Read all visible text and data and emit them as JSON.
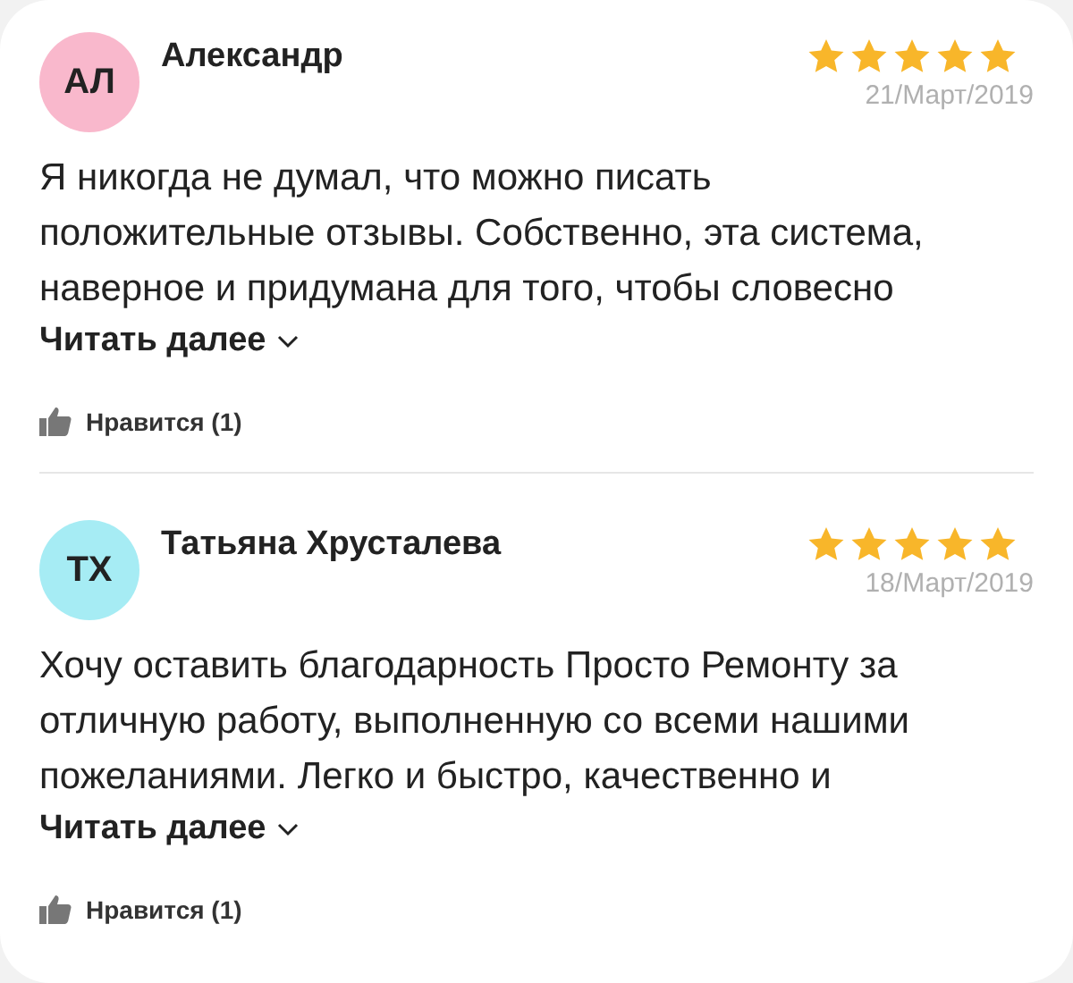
{
  "reviews": [
    {
      "initials": "АЛ",
      "color": "#f9b8cc",
      "name": "Александр",
      "stars": 5,
      "date": "21/Март/2019",
      "text_lines": [
        "Я никогда не думал, что можно писать",
        "положительные отзывы. Собственно, эта система,",
        "наверное и придумана для того, чтобы словесно"
      ],
      "read_more": "Читать далее",
      "like": "Нравится (1)"
    },
    {
      "initials": "ТХ",
      "color": "#a6ecf4",
      "name": "Татьяна Хрусталева",
      "stars": 5,
      "date": "18/Март/2019",
      "text_lines": [
        "Хочу оставить благодарность Просто Ремонту за",
        "отличную работу, выполненную со всеми нашими",
        "пожеланиями. Легко и быстро, качественно и"
      ],
      "read_more": "Читать далее",
      "like": "Нравится (1)"
    }
  ]
}
